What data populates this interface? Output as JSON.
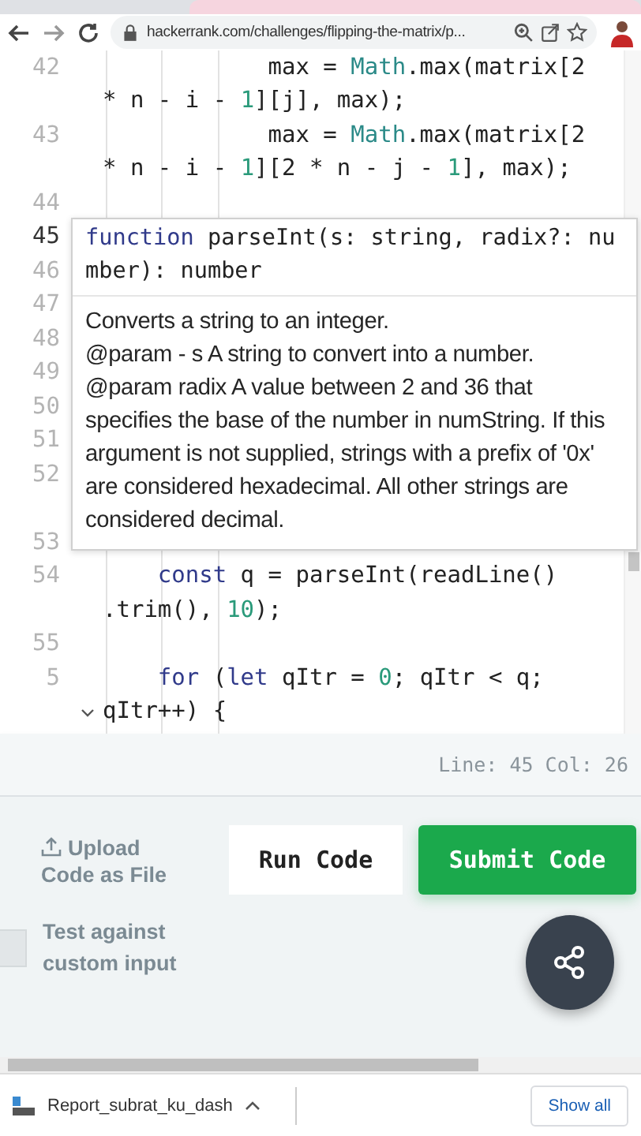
{
  "browser": {
    "url": "hackerrank.com/challenges/flipping-the-matrix/p..."
  },
  "editor": {
    "rows": [
      {
        "number": "42",
        "current": false,
        "tokens": [
          {
            "kind": "plain",
            "text": "            max = "
          },
          {
            "kind": "builtin",
            "text": "Math"
          },
          {
            "kind": "plain",
            "text": ".max(matrix[2"
          }
        ]
      },
      {
        "tokens": [
          {
            "kind": "plain",
            "text": "* n - i - "
          },
          {
            "kind": "number",
            "text": "1"
          },
          {
            "kind": "plain",
            "text": "][j], max);"
          }
        ]
      },
      {
        "number": "43",
        "current": false,
        "tokens": [
          {
            "kind": "plain",
            "text": "            max = "
          },
          {
            "kind": "builtin",
            "text": "Math"
          },
          {
            "kind": "plain",
            "text": ".max(matrix[2"
          }
        ]
      },
      {
        "tokens": [
          {
            "kind": "plain",
            "text": "* n - i - "
          },
          {
            "kind": "number",
            "text": "1"
          },
          {
            "kind": "plain",
            "text": "][2 * n - j - "
          },
          {
            "kind": "number",
            "text": "1"
          },
          {
            "kind": "plain",
            "text": "], max);"
          }
        ]
      },
      {
        "number": "44",
        "current": false
      },
      {
        "number": "45",
        "current": true
      },
      {
        "number": "46",
        "current": false
      },
      {
        "number": "47",
        "current": false
      },
      {
        "number": "48",
        "current": false
      },
      {
        "number": "49",
        "current": false
      },
      {
        "number": "50",
        "current": false
      },
      {
        "number": "51",
        "current": false
      },
      {
        "number": "52",
        "current": false
      },
      {},
      {
        "number": "53",
        "current": false
      },
      {
        "number": "54",
        "current": false,
        "tokens": [
          {
            "kind": "keyword",
            "text": "    const"
          },
          {
            "kind": "plain",
            "text": " q = parseInt(readLine()"
          }
        ]
      },
      {
        "tokens": [
          {
            "kind": "plain",
            "text": ".trim(), "
          },
          {
            "kind": "number",
            "text": "10"
          },
          {
            "kind": "plain",
            "text": ");"
          }
        ]
      },
      {
        "number": "55",
        "current": false
      },
      {
        "number": "5",
        "current": false,
        "tokens": [
          {
            "kind": "keyword",
            "text": "    for"
          },
          {
            "kind": "plain",
            "text": " ("
          },
          {
            "kind": "keyword",
            "text": "let"
          },
          {
            "kind": "plain",
            "text": " qItr = "
          },
          {
            "kind": "number",
            "text": "0"
          },
          {
            "kind": "plain",
            "text": "; qItr < q;"
          }
        ]
      },
      {
        "folded": false,
        "tokens": [
          {
            "kind": "plain",
            "text": "qItr++) {"
          }
        ]
      }
    ],
    "tooltip": {
      "signature": [
        {
          "kind": "keyword",
          "text": "function"
        },
        {
          "kind": "plain",
          "text": " parseInt(s: string, radix?: number): number"
        }
      ],
      "doc": [
        "Converts a string to an integer.",
        "@param - s A string to convert into a number.",
        "@param radix A value between 2 and 36 that specifies the base of the number in numString. If this argument is not supplied, strings with a prefix of '0x' are considered hexadecimal. All other strings are considered decimal."
      ]
    },
    "status": "Line: 45 Col: 26"
  },
  "actions": {
    "upload": "Upload Code as File",
    "run": "Run Code",
    "submit": "Submit Code",
    "custom_input": {
      "label": "Test against custom input",
      "checked": false
    }
  },
  "downloads": {
    "file": "Report_subrat_ku_dash",
    "show_all": "Show all"
  }
}
